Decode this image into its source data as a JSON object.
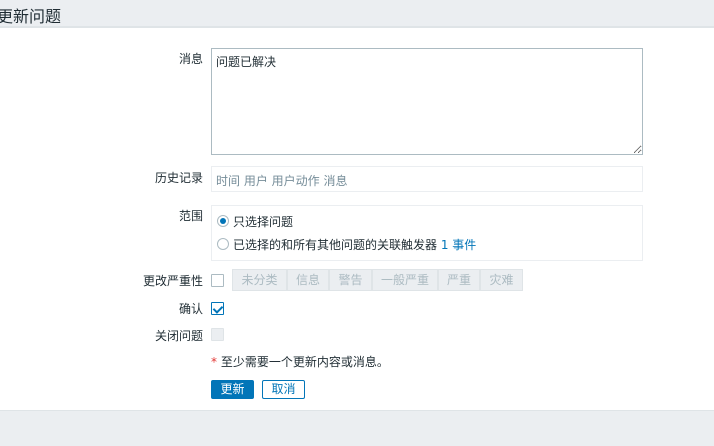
{
  "title": "更新问题",
  "form": {
    "message_label": "消息",
    "message_value": "问题已解决",
    "history_label": "历史记录",
    "history_columns": "时间 用户 用户动作 消息",
    "scope_label": "范围",
    "scope_options": [
      {
        "label": "只选择问题",
        "selected": true
      },
      {
        "label": "已选择的和所有其他问题的关联触发器",
        "suffix": "1 事件",
        "selected": false
      }
    ],
    "severity_label": "更改严重性",
    "severity_checked": false,
    "severities": [
      "未分类",
      "信息",
      "警告",
      "一般严重",
      "严重",
      "灾难"
    ],
    "ack_label": "确认",
    "ack_checked": true,
    "close_label": "关闭问题",
    "close_disabled": true,
    "note_star": "*",
    "note": "至少需要一个更新内容或消息。",
    "update_button": "更新",
    "cancel_button": "取消"
  },
  "colors": {
    "accent": "#0275b8",
    "note_star": "#e33734"
  }
}
